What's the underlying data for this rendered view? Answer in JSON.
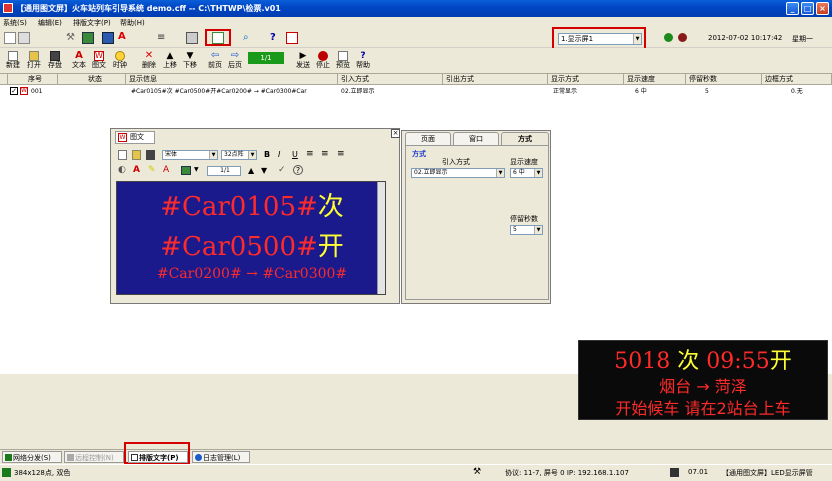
{
  "window": {
    "title": "【通用图文屏】火车站列车引导系统 demo.cff -- C:\\THTWP\\检票.v01",
    "minimize": "_",
    "maximize": "□",
    "close": "×"
  },
  "menu": [
    "系统(S)",
    "编辑(E)",
    "排版文字(P)",
    "帮助(H)"
  ],
  "toolbar": {
    "screen_select": "1.显示屏1",
    "datetime": "2012-07-02 10:17:42",
    "weekday": "星期一",
    "page_value": "1/1",
    "tools": [
      {
        "label": "新建",
        "icon": "new-icon"
      },
      {
        "label": "打开",
        "icon": "open-icon"
      },
      {
        "label": "存盘",
        "icon": "save-icon"
      },
      {
        "label": "文本",
        "icon": "text-icon"
      },
      {
        "label": "图文",
        "icon": "image-text-icon"
      },
      {
        "label": "时钟",
        "icon": "clock-icon"
      },
      {
        "label": "删除",
        "icon": "delete-icon"
      },
      {
        "label": "上移",
        "icon": "move-up-icon"
      },
      {
        "label": "下移",
        "icon": "move-down-icon"
      },
      {
        "label": "前页",
        "icon": "prev-page-icon"
      },
      {
        "label": "后页",
        "icon": "next-page-icon"
      },
      {
        "label": "发送",
        "icon": "send-icon"
      },
      {
        "label": "停止",
        "icon": "stop-icon"
      },
      {
        "label": "预览",
        "icon": "preview-icon"
      },
      {
        "label": "帮助",
        "icon": "help-icon"
      }
    ]
  },
  "grid": {
    "headers": [
      "序号",
      "状态",
      "显示信息",
      "引入方式",
      "引出方式",
      "显示方式",
      "显示速度",
      "停留秒数",
      "边框方式"
    ],
    "rows": [
      {
        "no": "001",
        "status": "",
        "info": "#Car0105#次 #Car0500#开#Car0200# → #Car0300#Car",
        "in": "02.立即显示",
        "out": "",
        "mode": "正常显示",
        "speed": "6 中",
        "stay": "5",
        "border": "0.无"
      }
    ]
  },
  "editor": {
    "tab": "图文",
    "font": "宋体",
    "size": "32点阵",
    "page": "1/1",
    "lines": [
      {
        "a": "#Car0105#",
        "b": "次"
      },
      {
        "a": "#Car0500#",
        "b": "开"
      },
      {
        "a": "#Car0200# → #Car0300#",
        "b": ""
      }
    ],
    "colors": {
      "bg": "#1a1a8c",
      "red": "#ff2a2a",
      "yellow": "#ffff33"
    }
  },
  "props": {
    "tabs": [
      "页面",
      "窗口",
      "方式"
    ],
    "group": "方式",
    "in_label": "引入方式",
    "in_value": "02.立即显示",
    "speed_label": "显示速度",
    "speed_value": "6 中",
    "stay_label": "停留秒数",
    "stay_value": "5"
  },
  "preview": {
    "line1_a": "5018",
    "line1_b": "次",
    "line1_c": "09:55",
    "line1_d": "开",
    "line2": "烟台 → 菏泽",
    "line3": "开始候车 请在2站台上车"
  },
  "bottom_tabs": [
    "网络分发(S)",
    "远程控制(N)",
    "排版文字(P)",
    "日志管理(L)"
  ],
  "status": {
    "size": "384x128点, 双色",
    "protocol": "协议: 11-7, 屏号 0 IP: 192.168.1.107",
    "version": "07.01",
    "product": "【通用图文屏】LED显示屏管"
  }
}
